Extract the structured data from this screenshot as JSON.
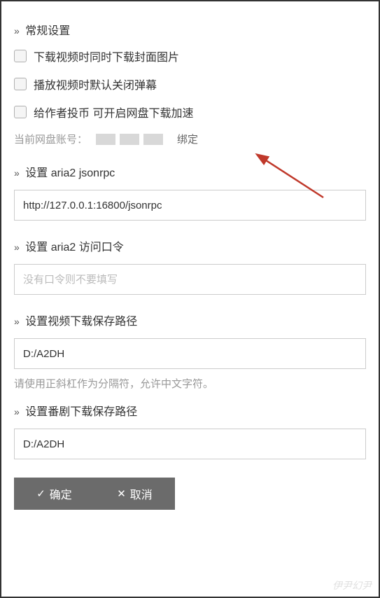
{
  "sections": {
    "general": "常规设置",
    "aria2_jsonrpc": "设置 aria2 jsonrpc",
    "aria2_token": "设置 aria2 访问口令",
    "video_path": "设置视频下载保存路径",
    "bangumi_path": "设置番剧下载保存路径"
  },
  "checkboxes": {
    "download_cover": "下载视频时同时下载封面图片",
    "close_danmu": "播放视频时默认关闭弹幕",
    "coin_boost": "给作者投币 可开启网盘下载加速"
  },
  "account": {
    "label": "当前网盘账号：",
    "bind_text": "绑定"
  },
  "inputs": {
    "jsonrpc_value": "http://127.0.0.1:16800/jsonrpc",
    "token_placeholder": "没有口令则不要填写",
    "video_path_value": "D:/A2DH",
    "bangumi_path_value": "D:/A2DH"
  },
  "hints": {
    "path_hint": "请使用正斜杠作为分隔符，允许中文字符。"
  },
  "buttons": {
    "confirm": "确定",
    "cancel": "取消"
  },
  "watermark": "伊尹幻尹"
}
